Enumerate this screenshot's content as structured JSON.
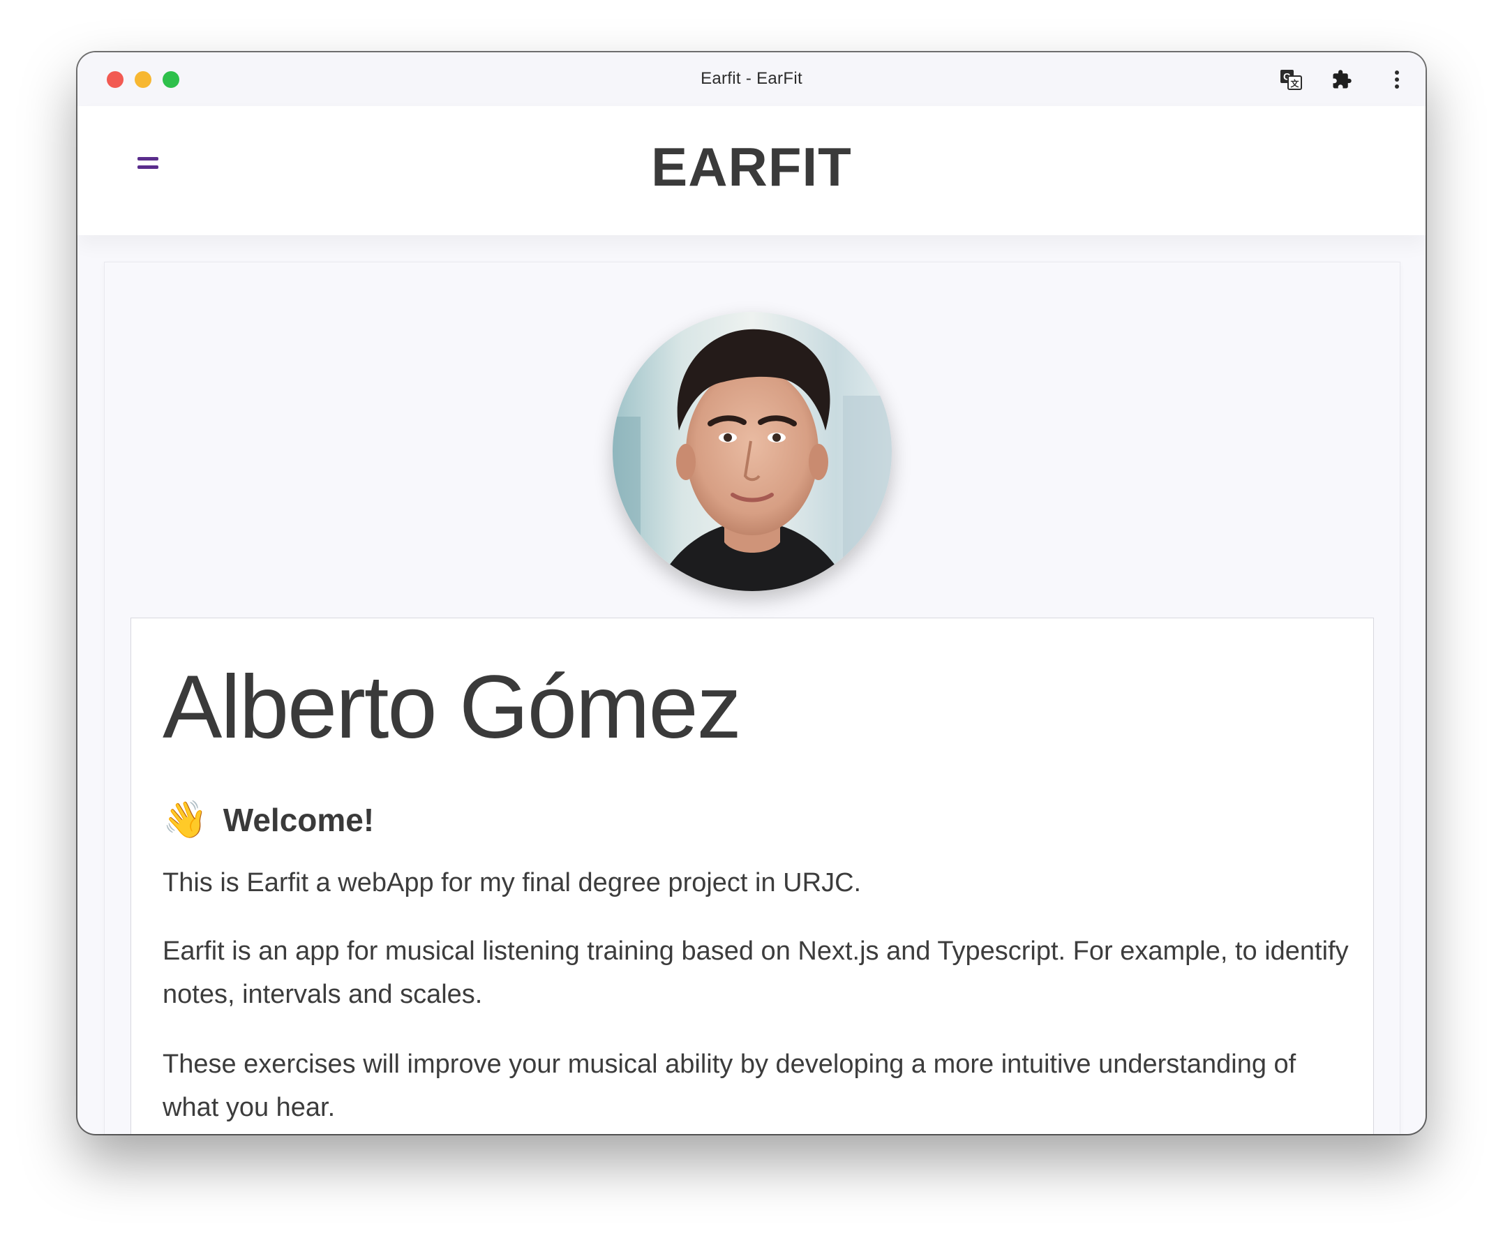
{
  "window": {
    "title": "Earfit - EarFit"
  },
  "toolbar": {
    "icons": [
      "translate-icon",
      "extensions-puzzle-icon",
      "more-vertical-icon"
    ]
  },
  "header": {
    "menu_icon": "menu-icon",
    "brand": "EARFIT",
    "accent_color": "#5a2d8c"
  },
  "profile": {
    "name": "Alberto Gómez",
    "welcome_emoji": "👋",
    "welcome_heading": "Welcome!",
    "paragraphs": [
      "This is Earfit a webApp for my final degree project in URJC.",
      "Earfit is an app for musical listening training based on Next.js and Typescript. For example, to identify notes, intervals and scales.",
      "These exercises will improve your musical ability by developing a more intuitive understanding of what you hear."
    ]
  }
}
